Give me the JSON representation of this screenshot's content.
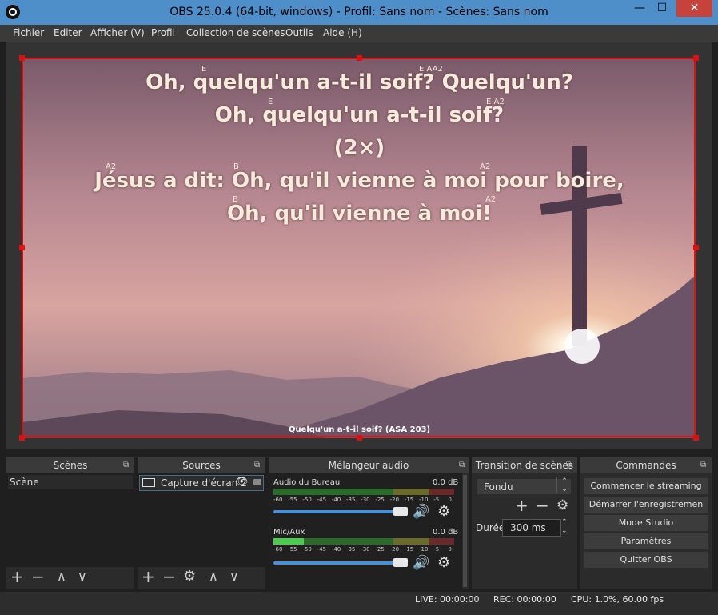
{
  "window": {
    "title": "OBS 25.0.4 (64-bit, windows) - Profil: Sans nom - Scènes: Sans nom",
    "minimize": "—",
    "maximize": "☐",
    "close": "✕"
  },
  "menu": {
    "items": [
      {
        "label": "Fichier",
        "ul": "F",
        "rest": "ichier"
      },
      {
        "label": "Editer",
        "ul": "E",
        "rest": "diter"
      },
      {
        "label": "Afficher (V)",
        "ul": "",
        "rest": "Afficher (V)"
      },
      {
        "label": "Profil",
        "ul": "P",
        "rest": "rofil"
      },
      {
        "label": "Collection de scènes",
        "ul": "",
        "rest": "Collection de scènes"
      },
      {
        "label": "Outils",
        "ul": "",
        "rest": "Outils"
      },
      {
        "label": "Aide (H)",
        "ul": "",
        "rest": "Aide (H)"
      }
    ]
  },
  "preview": {
    "lines": [
      "Oh, quelqu'un a-t-il soif? Quelqu'un?",
      "Oh, quelqu'un a-t-il soif?",
      "(2×)",
      "Jésus a dit: Oh, qu'il vienne à moi pour boire,",
      "Oh, qu'il vienne à moi!"
    ],
    "chords": [
      "E",
      "E AA2",
      "E",
      "E A2",
      "A2",
      "B",
      "A2",
      "B",
      "A2"
    ],
    "caption": "Quelqu'un a-t-il soif? (ASA 203)"
  },
  "scenes": {
    "title": "Scènes",
    "items": [
      "Scène"
    ]
  },
  "sources": {
    "title": "Sources",
    "items": [
      "Capture d'écran 2"
    ]
  },
  "mixer": {
    "title": "Mélangeur audio",
    "scale": [
      "-60",
      "-55",
      "-50",
      "-45",
      "-40",
      "-35",
      "-30",
      "-25",
      "-20",
      "-15",
      "-10",
      "-5",
      "0"
    ],
    "channels": [
      {
        "name": "Audio du Bureau",
        "db": "0.0 dB",
        "level": 0
      },
      {
        "name": "Mic/Aux",
        "db": "0.0 dB",
        "level": 0.17
      }
    ]
  },
  "transitions": {
    "title": "Transition de scènes",
    "selected": "Fondu",
    "duration_label": "Durée",
    "duration_value": "300 ms"
  },
  "controls": {
    "title": "Commandes",
    "buttons": [
      "Commencer le streaming",
      "Démarrer l'enregistremen",
      "Mode Studio",
      "Paramètres",
      "Quitter OBS"
    ]
  },
  "status": {
    "live": "LIVE: 00:00:00",
    "rec": "REC: 00:00:00",
    "cpu": "CPU: 1.0%, 60.00 fps"
  },
  "colors": {
    "accent": "#4e8fc9",
    "selection": "#e01010",
    "slider": "#4a90d9",
    "close": "#c7423a"
  }
}
